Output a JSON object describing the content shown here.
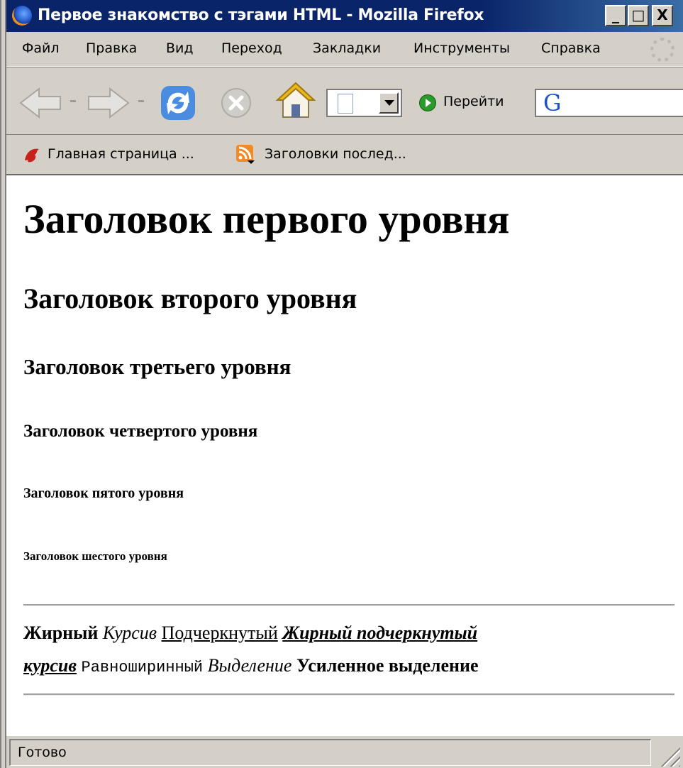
{
  "window": {
    "title": "Первое знакомство с тэгами HTML - Mozilla Firefox",
    "buttons": [
      "_",
      "□",
      "X"
    ]
  },
  "menubar": {
    "items": [
      "Файл",
      "Правка",
      "Вид",
      "Переход",
      "Закладки",
      "Инструменты",
      "Справка"
    ]
  },
  "navbar": {
    "icons": [
      "back-arrow-icon",
      "forward-arrow-icon",
      "reload-icon",
      "stop-icon",
      "home-icon",
      "page-icon"
    ],
    "go_label": "Перейти",
    "search_engine_letter": "G"
  },
  "bookmarks": {
    "items": [
      {
        "icon": "firefox-bookmark-icon",
        "label": "Главная страница ..."
      },
      {
        "icon": "rss-feed-icon",
        "label": "Заголовки послед..."
      }
    ]
  },
  "content": {
    "h1": "Заголовок первого уровня",
    "h2": "Заголовок второго уровня",
    "h3": "Заголовок третьего уровня",
    "h4": "Заголовок четвертого уровня",
    "h5": "Заголовок пятого уровня",
    "h6": "Заголовок шестого уровня",
    "bold": "Жирный",
    "italic": "Курсив",
    "underline": "Подчеркнутый",
    "bold_underline_italic_1": "Жирный подчеркнутый",
    "bold_underline_italic_2": "курсив",
    "monospace": "Равноширинный",
    "emphasis": "Выделение",
    "strong": "Усиленное выделение"
  },
  "statusbar": {
    "text": "Готово"
  },
  "colors": {
    "titlebar": "#0a246a",
    "chrome": "#d4d0c8",
    "content_bg": "#ffffff"
  }
}
